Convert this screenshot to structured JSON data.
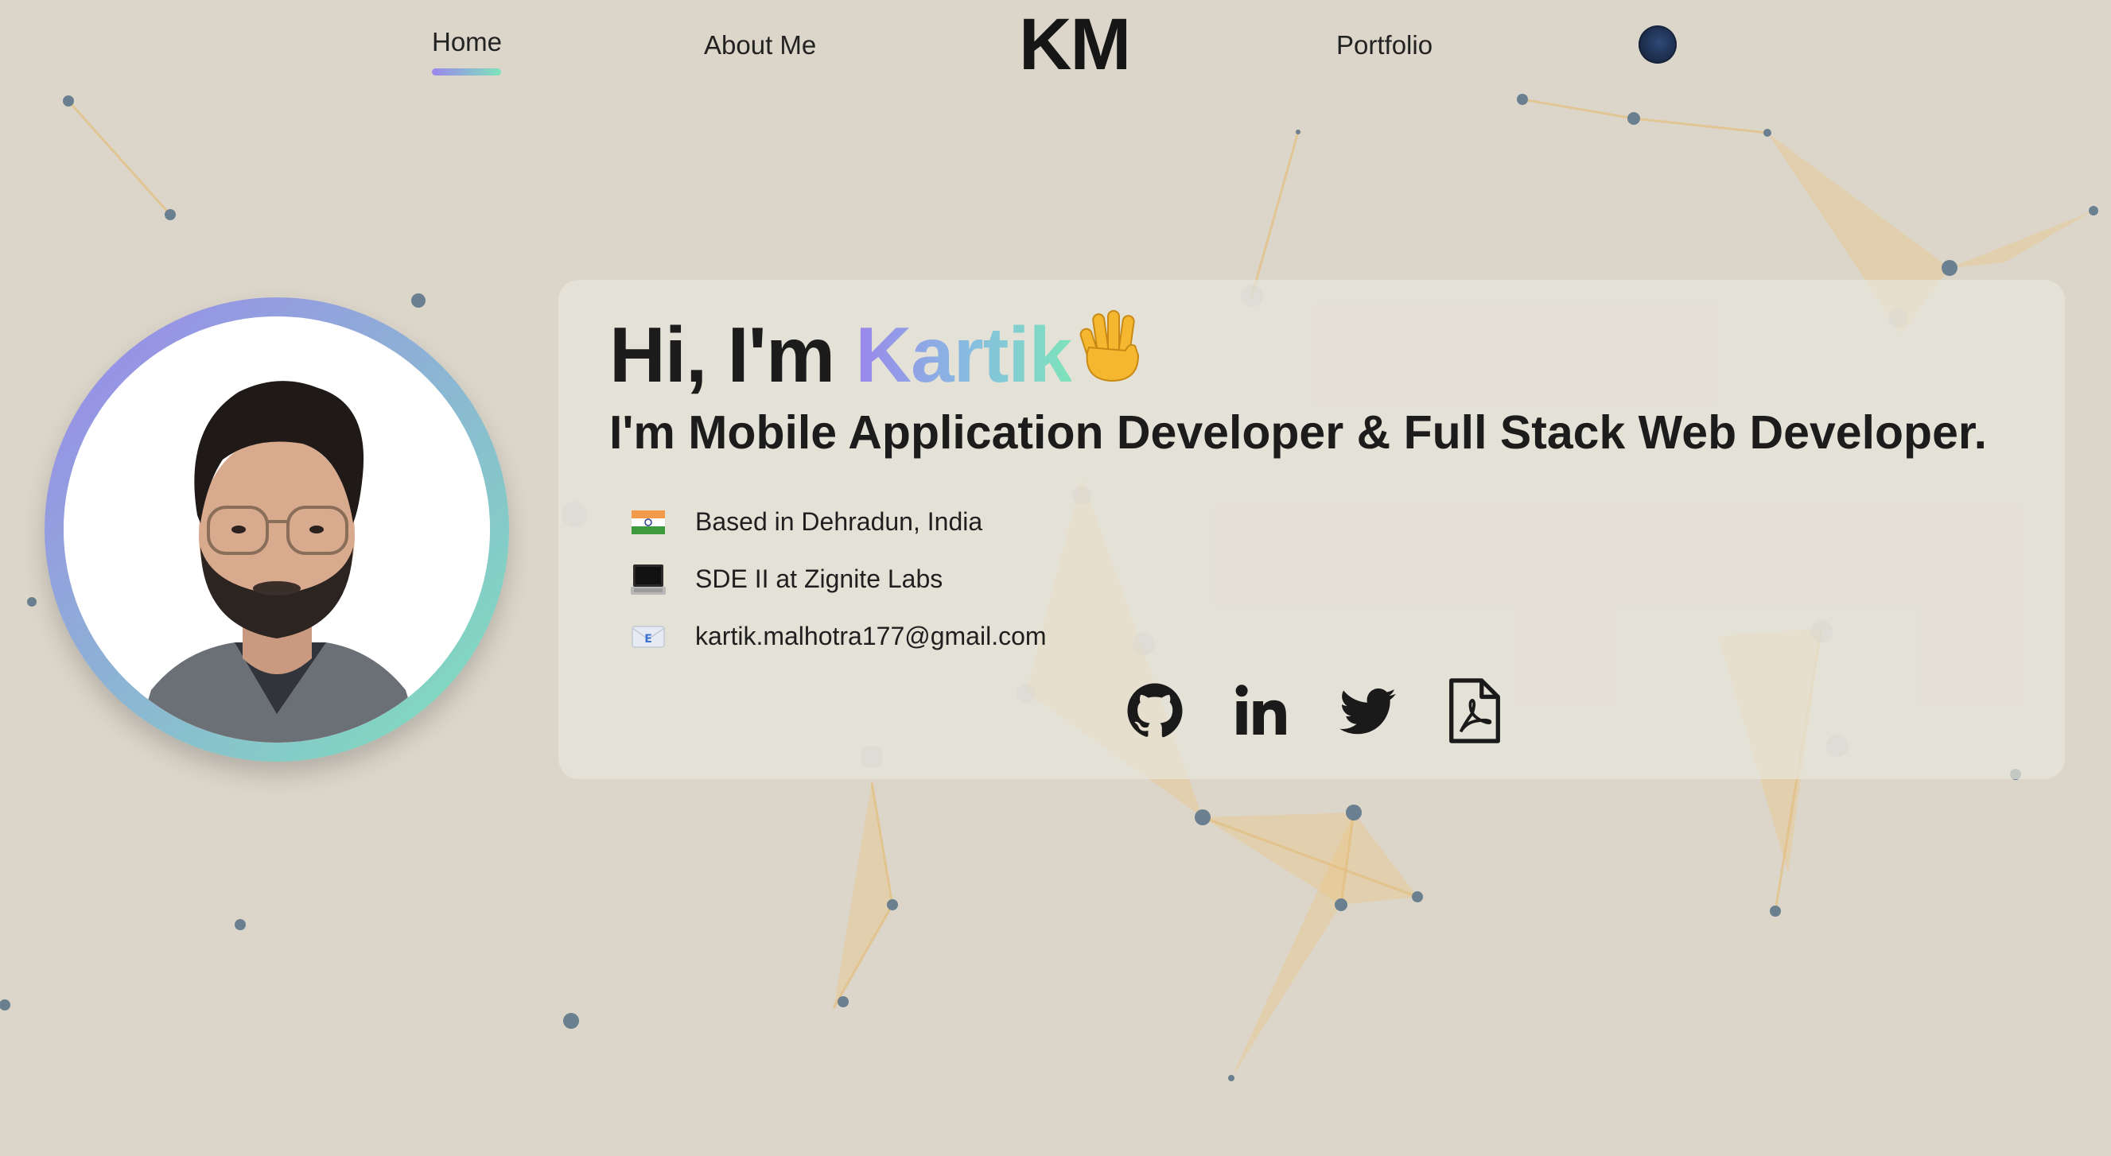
{
  "nav": {
    "home_label": "Home",
    "about_label": "About Me",
    "logo_text": "KM",
    "portfolio_label": "Portfolio",
    "theme_toggle_icon": "moon-globe-icon"
  },
  "hero": {
    "greeting_prefix": "Hi, I'm ",
    "greeting_name": "Kartik",
    "wave_icon": "waving-hand-icon",
    "headline": "I'm Mobile Application Developer & Full Stack Web Developer.",
    "info": [
      {
        "icon": "india-flag-icon",
        "text": "Based in Dehradun, India"
      },
      {
        "icon": "laptop-icon",
        "text": "SDE II at Zignite Labs"
      },
      {
        "icon": "envelope-icon",
        "text": "kartik.malhotra177@gmail.com"
      }
    ],
    "socials": [
      {
        "icon": "github-icon"
      },
      {
        "icon": "linkedin-icon"
      },
      {
        "icon": "twitter-icon"
      },
      {
        "icon": "resume-pdf-icon"
      }
    ]
  },
  "theme": {
    "background": "#dcd6ca",
    "accent_start": "#9b86ec",
    "accent_end": "#7de3bb",
    "node_color": "#6a8090",
    "polygon_color": "#eec27a"
  }
}
